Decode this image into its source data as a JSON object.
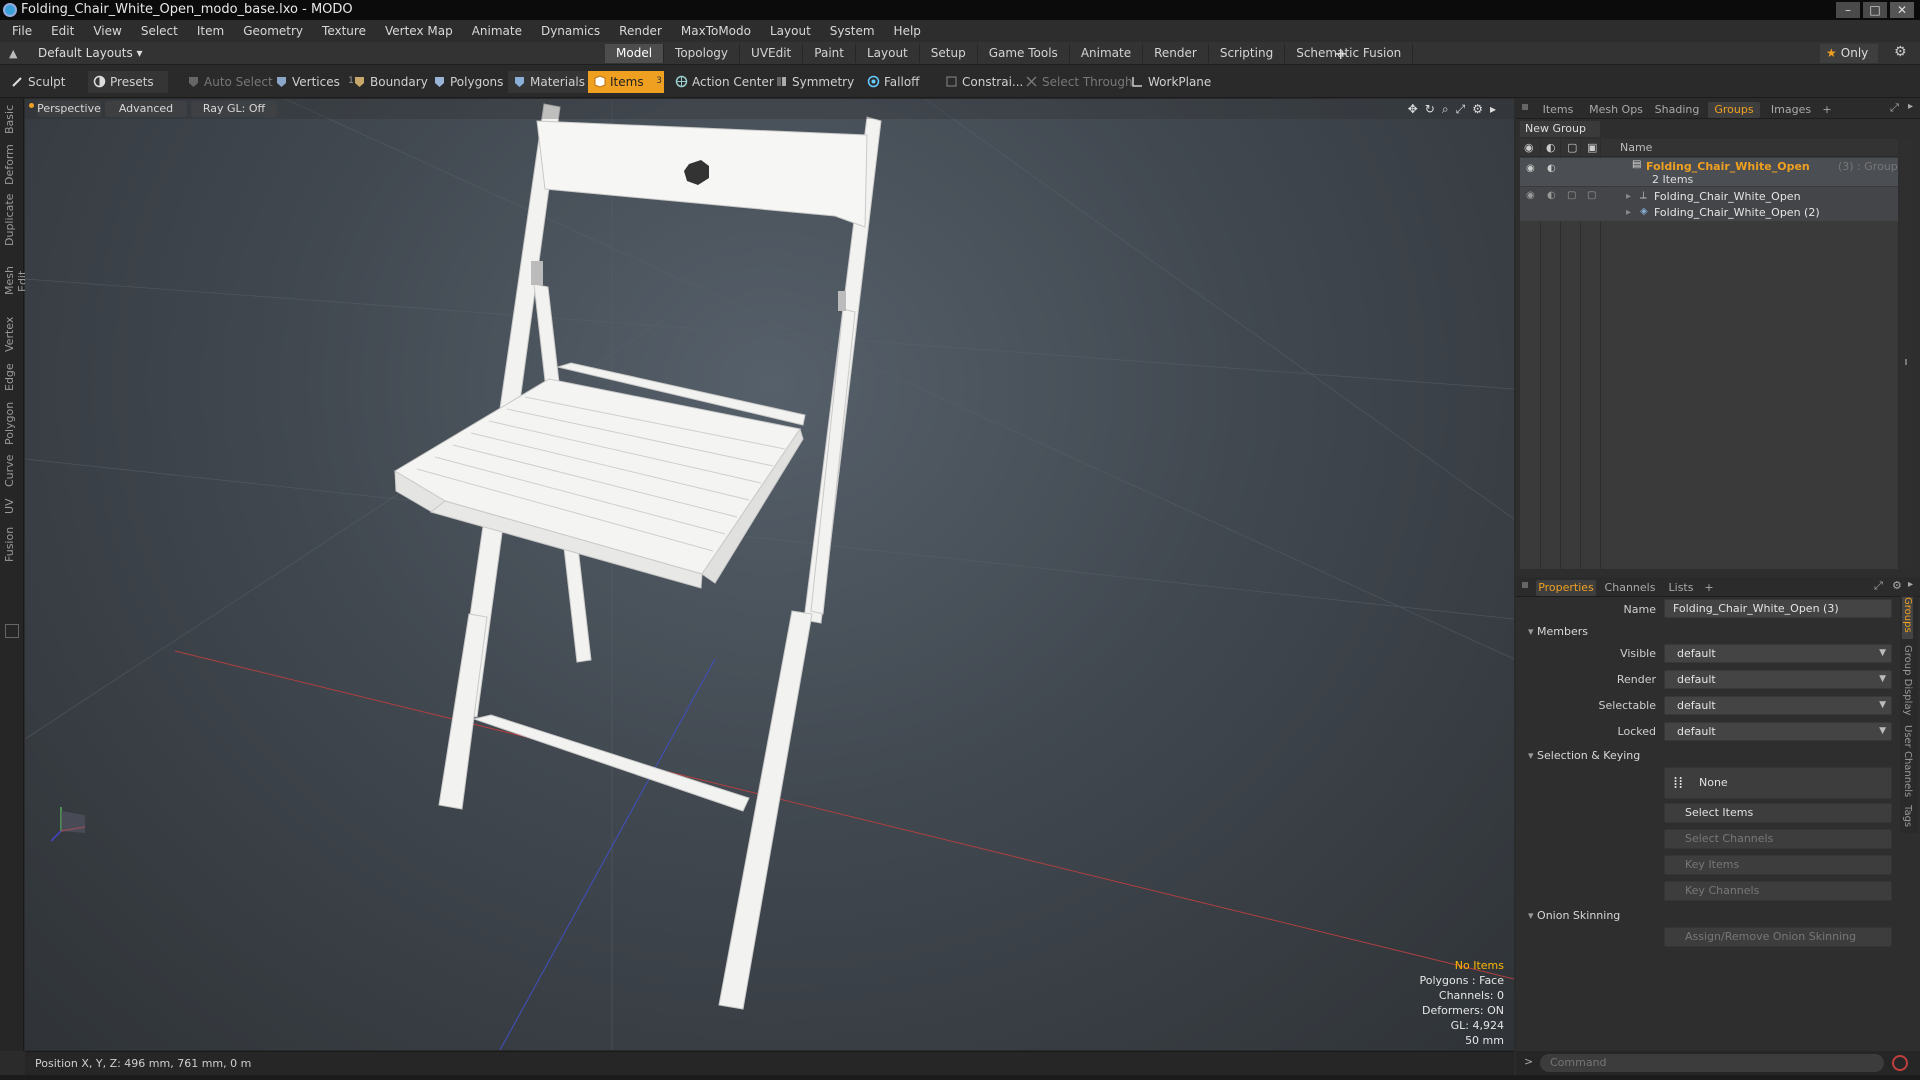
{
  "window": {
    "title": "Folding_Chair_White_Open_modo_base.lxo - MODO",
    "controls": [
      "–",
      "□",
      "✕"
    ]
  },
  "menu": [
    "File",
    "Edit",
    "View",
    "Select",
    "Item",
    "Geometry",
    "Texture",
    "Vertex Map",
    "Animate",
    "Dynamics",
    "Render",
    "MaxToModo",
    "Layout",
    "System",
    "Help"
  ],
  "layout_dropdown": "Default Layouts ▾",
  "mode_tabs": [
    "Model",
    "Topology",
    "UVEdit",
    "Paint",
    "Layout",
    "Setup",
    "Game Tools",
    "Animate",
    "Render",
    "Scripting",
    "Schematic Fusion"
  ],
  "active_mode_tab": "Model",
  "only_label": "Only",
  "toolbar": {
    "sculpt": "Sculpt",
    "presets": "Presets",
    "auto_select": "Auto Select",
    "vertices": "Vertices",
    "vertices_count": "1",
    "boundary": "Boundary",
    "polygons": "Polygons",
    "materials": "Materials",
    "items": "Items",
    "items_badge": "3",
    "action_center": "Action Center",
    "symmetry": "Symmetry",
    "falloff": "Falloff",
    "constrain": "Constrai...",
    "select_through": "Select Through",
    "workplane": "WorkPlane"
  },
  "left_tabs": [
    "Basic",
    "Deform",
    "Duplicate",
    "Mesh Edit",
    "Vertex",
    "Edge",
    "Polygon",
    "Curve",
    "UV",
    "Fusion"
  ],
  "viewport": {
    "view_mode": "Perspective",
    "shading": "Advanced",
    "raygl": "Ray GL: Off",
    "info": {
      "no_items": "No Items",
      "polygons": "Polygons : Face",
      "channels": "Channels: 0",
      "deformers": "Deformers: ON",
      "gl": "GL: 4,924",
      "scale": "50 mm"
    }
  },
  "status": {
    "position": "Position X, Y, Z:  496 mm, 761 mm, 0 m"
  },
  "top_panel_tabs": [
    "Items",
    "Mesh Ops",
    "Shading",
    "Groups",
    "Images",
    "+"
  ],
  "top_panel_active": "Groups",
  "groups": {
    "new_group": "New Group",
    "name_header": "Name",
    "group_name": "Folding_Chair_White_Open",
    "group_suffix": "(3) : Group",
    "item_count": "2 Items",
    "members": [
      "Folding_Chair_White_Open",
      "Folding_Chair_White_Open (2)"
    ]
  },
  "bottom_panel_tabs": [
    "Properties",
    "Channels",
    "Lists",
    "+"
  ],
  "bottom_panel_active": "Properties",
  "properties": {
    "name_label": "Name",
    "name_value": "Folding_Chair_White_Open (3)",
    "members_section": "Members",
    "visible_label": "Visible",
    "visible_value": "default",
    "render_label": "Render",
    "render_value": "default",
    "selectable_label": "Selectable",
    "selectable_value": "default",
    "locked_label": "Locked",
    "locked_value": "default",
    "selection_section": "Selection & Keying",
    "none_label": "None",
    "select_items": "Select Items",
    "select_channels": "Select Channels",
    "key_items": "Key Items",
    "key_channels": "Key Channels",
    "onion_section": "Onion Skinning",
    "onion_button": "Assign/Remove Onion Skinning"
  },
  "side_vtabs": [
    "Groups",
    "Group Display",
    "User Channels",
    "Tags"
  ],
  "command_placeholder": "Command",
  "colors": {
    "accent": "#f0a020",
    "chair": "#f2f2f0",
    "viewport_bg": "#414850"
  }
}
